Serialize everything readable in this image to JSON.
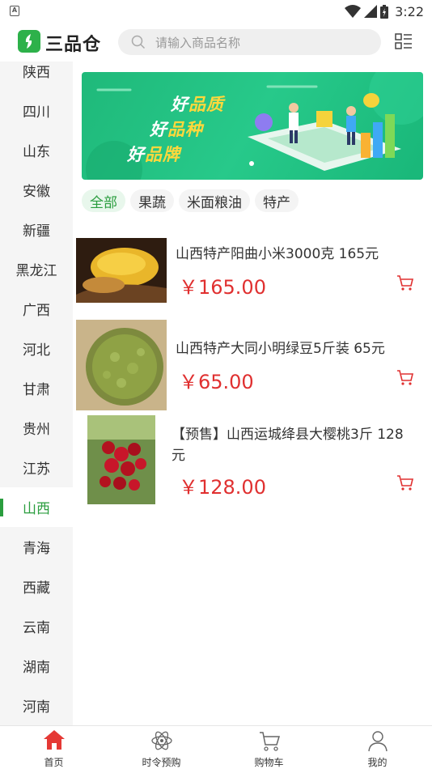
{
  "status": {
    "time": "3:22",
    "left_badge": "A"
  },
  "header": {
    "app_name": "三品仓",
    "search_placeholder": "请输入商品名称",
    "icons": {
      "logo": "leaf-logo-icon",
      "search": "search-icon",
      "menu": "list-menu-icon"
    }
  },
  "sidebar": {
    "items": [
      {
        "label": "陕西"
      },
      {
        "label": "四川"
      },
      {
        "label": "山东"
      },
      {
        "label": "安徽"
      },
      {
        "label": "新疆"
      },
      {
        "label": "黑龙江"
      },
      {
        "label": "广西"
      },
      {
        "label": "河北"
      },
      {
        "label": "甘肃"
      },
      {
        "label": "贵州"
      },
      {
        "label": "江苏"
      },
      {
        "label": "山西"
      },
      {
        "label": "青海"
      },
      {
        "label": "西藏"
      },
      {
        "label": "云南"
      },
      {
        "label": "湖南"
      },
      {
        "label": "河南"
      }
    ],
    "active": "山西"
  },
  "banner": {
    "line1_a": "好",
    "line1_b": "品质",
    "line2_a": "好",
    "line2_b": "品种",
    "line3_a": "好",
    "line3_b": "品牌"
  },
  "categories": {
    "items": [
      {
        "label": "全部"
      },
      {
        "label": "果蔬"
      },
      {
        "label": "米面粮油"
      },
      {
        "label": "特产"
      }
    ],
    "active": "全部"
  },
  "products": [
    {
      "name": "山西特产阳曲小米3000克 165元",
      "price": "￥165.00",
      "image": "millet-photo"
    },
    {
      "name": "山西特产大同小明绿豆5斤装 65元",
      "price": "￥65.00",
      "image": "mung-bean-photo"
    },
    {
      "name": "【预售】山西运城绛县大樱桃3斤 128元",
      "price": "￥128.00",
      "image": "cherry-photo"
    }
  ],
  "bottom_nav": {
    "items": [
      {
        "label": "首页",
        "icon": "home-icon"
      },
      {
        "label": "时令预购",
        "icon": "atom-icon"
      },
      {
        "label": "购物车",
        "icon": "cart-icon"
      },
      {
        "label": "我的",
        "icon": "user-icon"
      }
    ],
    "active": "首页"
  },
  "colors": {
    "brand_green": "#2a9d3e",
    "price_red": "#e03030",
    "home_red": "#e53935"
  }
}
